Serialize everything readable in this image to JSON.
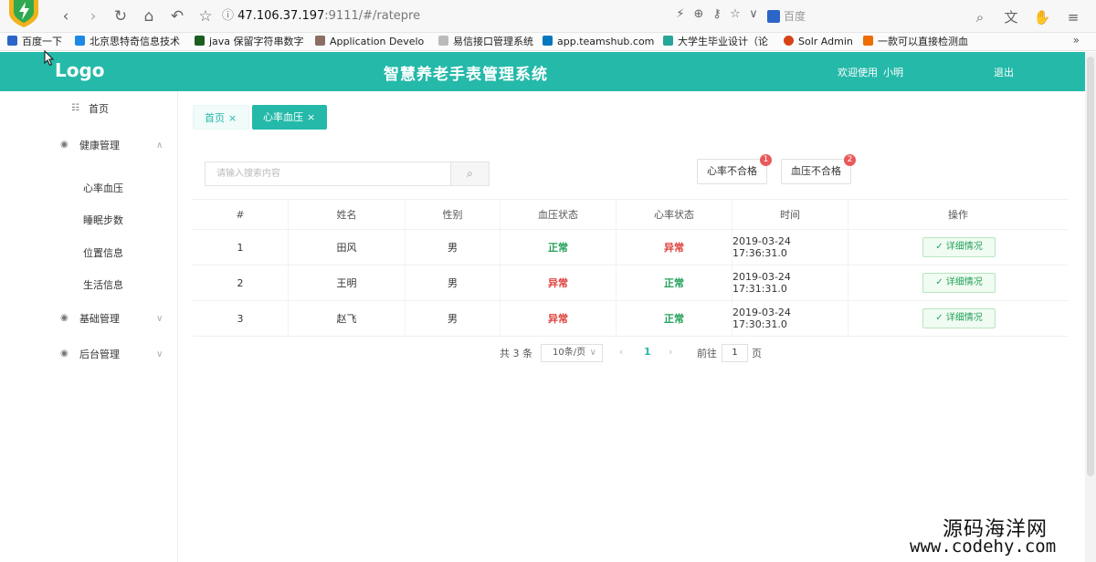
{
  "browser": {
    "url_host": "47.106.37.197",
    "url_rest": ":9111/#/ratepre",
    "search_placeholder": "百度",
    "bookmarks": [
      "百度一下",
      "北京思特奇信息技术",
      "java 保留字符串数字",
      "Application Develo",
      "易信接口管理系统",
      "app.teamshub.com",
      "大学生毕业设计（论",
      "Solr Admin",
      "一款可以直接检测血"
    ]
  },
  "header": {
    "logo": "Logo",
    "title": "智慧养老手表管理系统",
    "welcome": "欢迎使用",
    "user": "小明",
    "logout": "退出"
  },
  "sidebar": {
    "home": "首页",
    "health": "健康管理",
    "sub": [
      "心率血压",
      "睡眠步数",
      "位置信息",
      "生活信息"
    ],
    "basic": "基础管理",
    "backend": "后台管理"
  },
  "tabs": {
    "home": "首页",
    "active": "心率血压"
  },
  "search": {
    "placeholder": "请输入搜索内容"
  },
  "filters": {
    "heart": "心率不合格",
    "heart_count": "1",
    "blood": "血压不合格",
    "blood_count": "2"
  },
  "table": {
    "headers": [
      "#",
      "姓名",
      "性别",
      "血压状态",
      "心率状态",
      "时间",
      "操作"
    ],
    "rows": [
      {
        "idx": "1",
        "name": "田风",
        "gender": "男",
        "bp": "正常",
        "hr": "异常",
        "time": "2019-03-24 17:36:31.0",
        "action": "详细情况"
      },
      {
        "idx": "2",
        "name": "王明",
        "gender": "男",
        "bp": "异常",
        "hr": "正常",
        "time": "2019-03-24 17:31:31.0",
        "action": "详细情况"
      },
      {
        "idx": "3",
        "name": "赵飞",
        "gender": "男",
        "bp": "异常",
        "hr": "正常",
        "time": "2019-03-24 17:30:31.0",
        "action": "详细情况"
      }
    ]
  },
  "pagination": {
    "total": "共 3 条",
    "page_size": "10条/页",
    "current": "1",
    "goto_label": "前往",
    "goto_value": "1",
    "page_label": "页"
  },
  "watermark": {
    "cn": "源码海洋网",
    "en": "www.codehy.com"
  },
  "colors": {
    "accent": "#25b9a9",
    "normal": "#22a25a",
    "abnormal": "#e0433e"
  }
}
